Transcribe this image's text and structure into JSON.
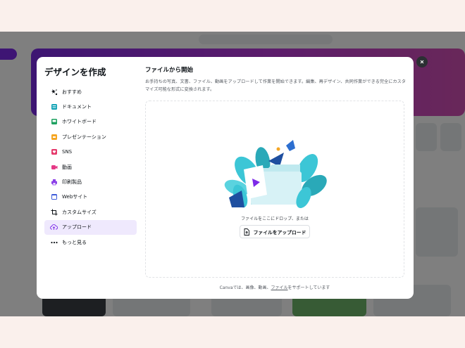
{
  "modal": {
    "title": "デザインを作成",
    "nav": [
      {
        "label": "おすすめ",
        "icon": "sparkle-icon",
        "active": false
      },
      {
        "label": "ドキュメント",
        "icon": "document-icon",
        "active": false
      },
      {
        "label": "ホワイトボード",
        "icon": "whiteboard-icon",
        "active": false
      },
      {
        "label": "プレゼンテーション",
        "icon": "presentation-icon",
        "active": false
      },
      {
        "label": "SNS",
        "icon": "heart-icon",
        "active": false
      },
      {
        "label": "動画",
        "icon": "video-icon",
        "active": false
      },
      {
        "label": "印刷製品",
        "icon": "printer-icon",
        "active": false
      },
      {
        "label": "Webサイト",
        "icon": "website-icon",
        "active": false
      },
      {
        "label": "カスタムサイズ",
        "icon": "crop-icon",
        "active": false
      },
      {
        "label": "アップロード",
        "icon": "cloud-upload-icon",
        "active": true
      },
      {
        "label": "もっと見る",
        "icon": "more-icon",
        "active": false
      }
    ],
    "content": {
      "title": "ファイルから開始",
      "description": "お手持ちの写真、文書、ファイル、動画をアップロードして作業を開始できます。編集、再デザイン、共同作業ができる完全にカスタマイズ可能な形式に変換されます。",
      "drop_text": "ファイルをここにドロップ、または",
      "upload_button": "ファイルをアップロード",
      "footer": {
        "prefix": "Canvaでは、画像、動画、",
        "link": "ファイル",
        "suffix": "をサポートしています"
      }
    }
  },
  "colors": {
    "accent": "#7d2ae8",
    "active_bg": "#efe9fd",
    "folder": "#bfe9ef",
    "leaf": "#3cc6d6"
  }
}
